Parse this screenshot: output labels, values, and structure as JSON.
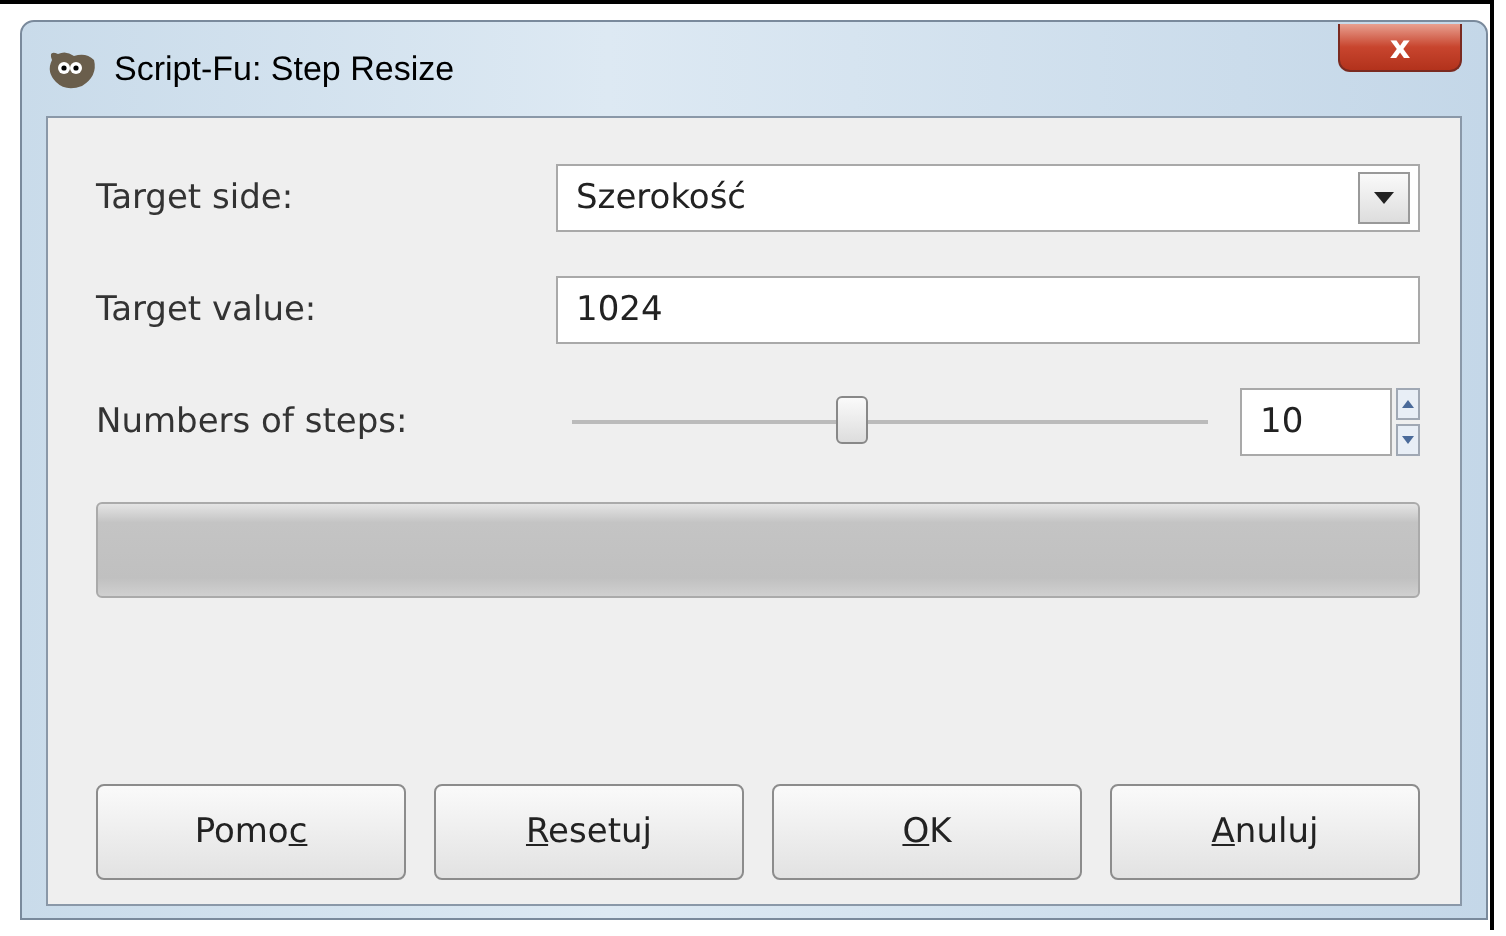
{
  "window": {
    "title": "Script-Fu: Step Resize",
    "close": "x"
  },
  "fields": [
    {
      "kind": "dropdown",
      "label": "Target side:",
      "value": "Szerokość"
    },
    {
      "kind": "text",
      "label": "Target value:",
      "value": "1024"
    },
    {
      "kind": "slider",
      "label": "Numbers of steps:",
      "level": 0.44,
      "value": "10"
    }
  ],
  "progress": {
    "level": 0
  },
  "buttons": [
    {
      "before": "Pomo",
      "key": "c"
    },
    {
      "key": "R",
      "after": "esetuj"
    },
    {
      "key": "O",
      "after": "K"
    },
    {
      "key": "A",
      "after": "nuluj"
    }
  ]
}
